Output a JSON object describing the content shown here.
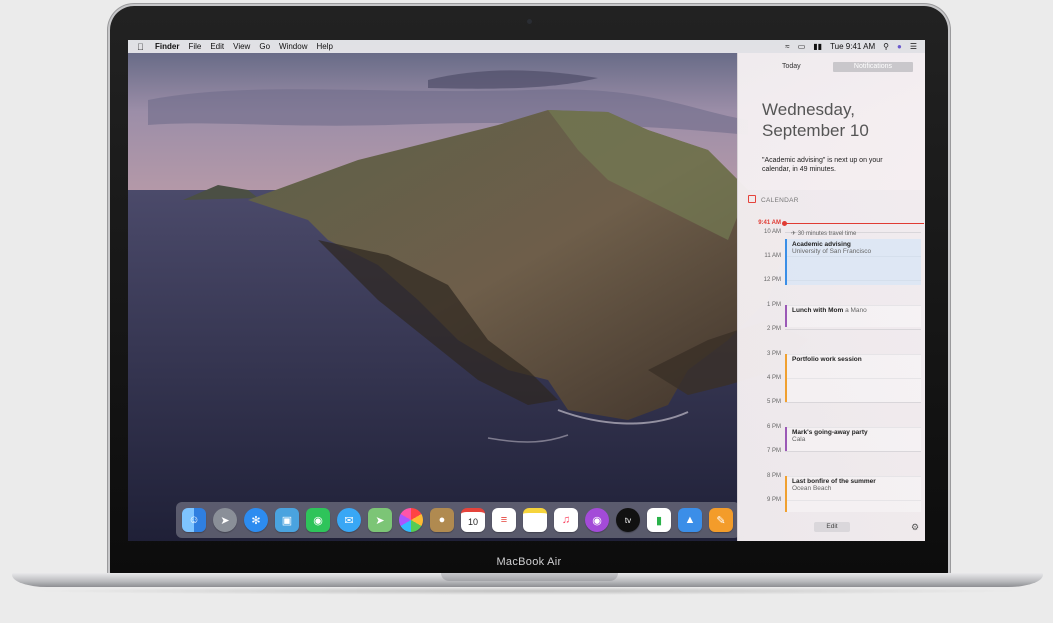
{
  "device": {
    "label": "MacBook Air"
  },
  "menubar": {
    "app": "Finder",
    "menus": [
      "File",
      "Edit",
      "View",
      "Go",
      "Window",
      "Help"
    ],
    "clock": "Tue 9:41 AM"
  },
  "notification_center": {
    "tabs": {
      "today": "Today",
      "notifications": "Notifications"
    },
    "date_line1": "Wednesday,",
    "date_line2": "September 10",
    "alert": "\"Academic advising\" is next up on your calendar, in 49 minutes.",
    "calendar_header": "CALENDAR",
    "now_label": "9:41 AM",
    "hours": [
      "10 AM",
      "11 AM",
      "12 PM",
      "1 PM",
      "2 PM",
      "3 PM",
      "4 PM",
      "5 PM",
      "6 PM",
      "7 PM",
      "8 PM",
      "9 PM"
    ],
    "travel": "30 minutes travel time",
    "events": [
      {
        "title": "Academic advising",
        "subtitle": "University of San Francisco"
      },
      {
        "title": "Lunch with Mom",
        "subtitle": "a Mano"
      },
      {
        "title": "Portfolio work session",
        "subtitle": ""
      },
      {
        "title": "Mark's going-away party",
        "subtitle": "Cala"
      },
      {
        "title": "Last bonfire of the summer",
        "subtitle": "Ocean Beach"
      }
    ],
    "edit_label": "Edit"
  },
  "dock": {
    "icons": [
      "finder",
      "launchpad",
      "safari",
      "preview",
      "facetime",
      "messages",
      "maps",
      "photos",
      "notes-book",
      "calendar",
      "reminders",
      "notes",
      "music",
      "podcasts",
      "tv",
      "numbers",
      "keynote",
      "pages"
    ],
    "calendar_day": "10",
    "tv_text": "tv"
  },
  "colors": {
    "accent_red": "#e03b33",
    "event_blue": "#3a8ee6",
    "event_purple": "#9b59b6",
    "event_orange": "#f0a030"
  }
}
